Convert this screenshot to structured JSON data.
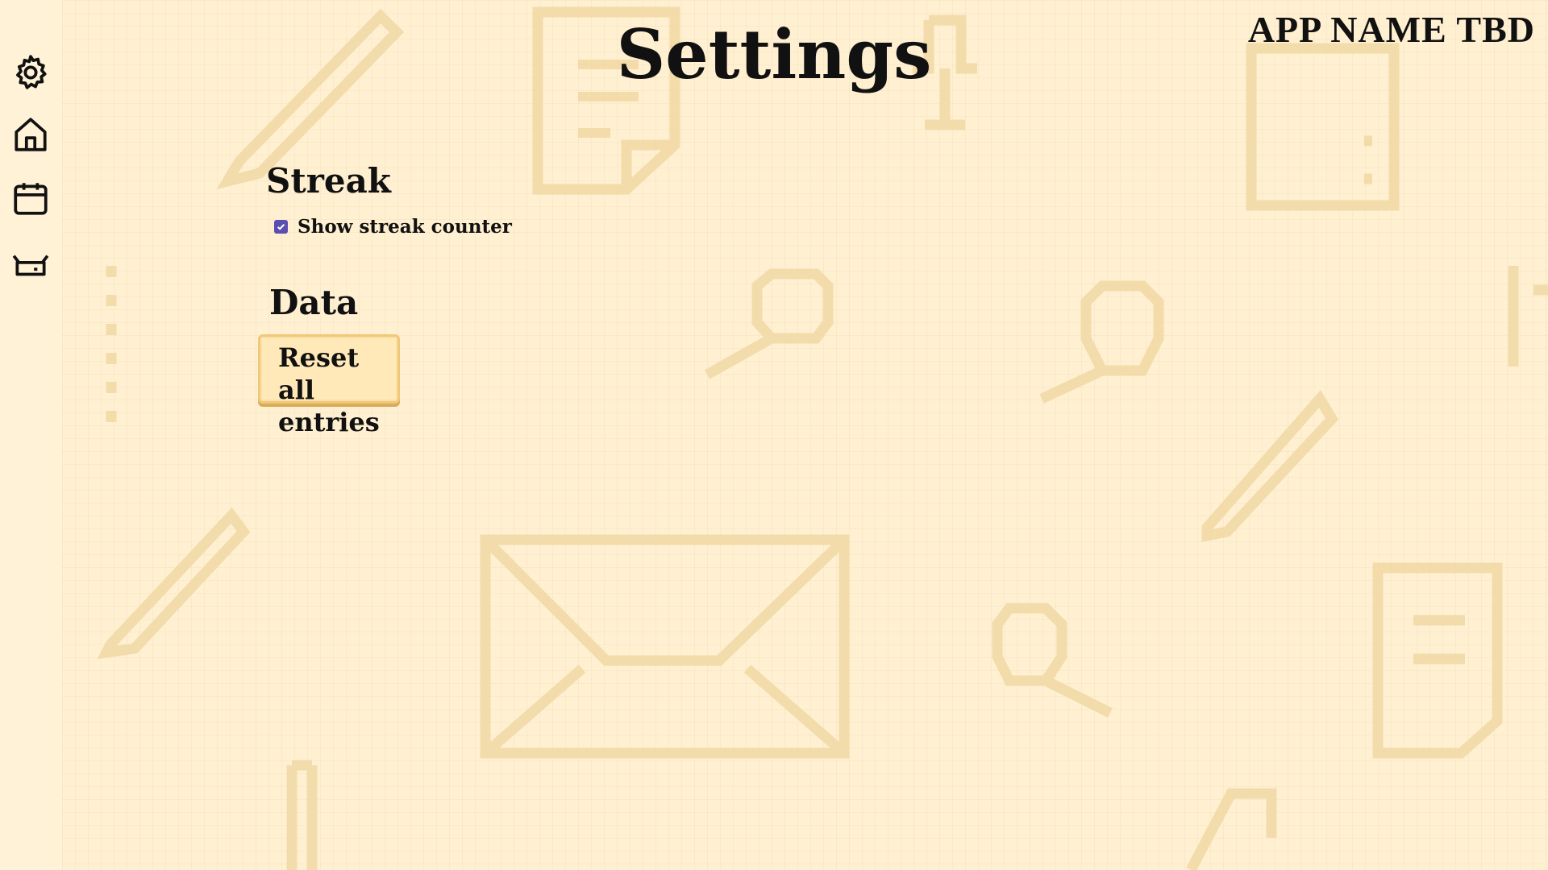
{
  "header": {
    "app_name": "APP NAME TBD",
    "page_title": "Settings"
  },
  "sidebar": {
    "items": [
      {
        "icon": "gear-icon",
        "label": ""
      },
      {
        "icon": "home-icon",
        "label": ""
      },
      {
        "icon": "calendar-icon",
        "label": ""
      },
      {
        "icon": "basket-icon",
        "label": ""
      }
    ]
  },
  "sections": {
    "streak": {
      "heading": "Streak",
      "show_counter_label": "Show streak counter",
      "show_counter_checked": true
    },
    "data": {
      "heading": "Data",
      "reset_label": "Reset all entries"
    }
  },
  "colors": {
    "background": "#fff2d6",
    "doodle": "#f2d9a6",
    "checkbox_accent": "#5a4fb0",
    "button_fill": "#ffe9b8",
    "button_border": "#f0c879"
  }
}
